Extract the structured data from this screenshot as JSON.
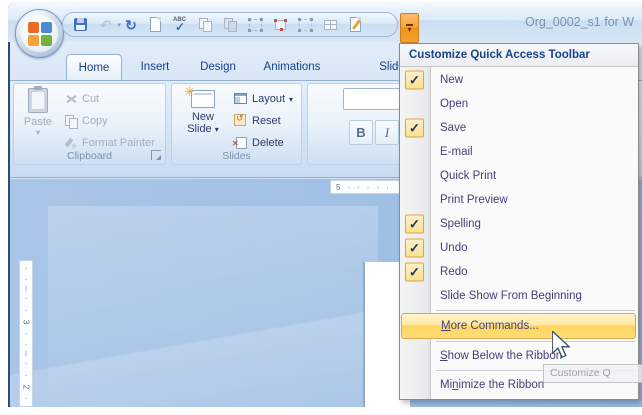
{
  "titlebar": {
    "title": "Org_0002_s1 for W"
  },
  "qat": {
    "icons": [
      {
        "name": "save",
        "disabled": false
      },
      {
        "name": "undo",
        "disabled": true,
        "has_dropdown": true
      },
      {
        "name": "redo",
        "disabled": false
      },
      {
        "name": "new-document",
        "disabled": false
      },
      {
        "name": "spelling",
        "disabled": false
      },
      {
        "name": "copy",
        "disabled": true
      },
      {
        "name": "duplicate",
        "disabled": true
      },
      {
        "name": "group-select",
        "disabled": true
      },
      {
        "name": "edit-points",
        "disabled": true
      },
      {
        "name": "select-objects",
        "disabled": true
      },
      {
        "name": "table",
        "disabled": true
      },
      {
        "name": "edit-slide",
        "disabled": false
      }
    ]
  },
  "tabs": [
    {
      "label": "Home",
      "active": true
    },
    {
      "label": "Insert",
      "active": false
    },
    {
      "label": "Design",
      "active": false
    },
    {
      "label": "Animations",
      "active": false
    },
    {
      "label": "Slide Show",
      "active": false
    }
  ],
  "ribbon": {
    "clipboard": {
      "group_label": "Clipboard",
      "paste_label": "Paste",
      "cut_label": "Cut",
      "copy_label": "Copy",
      "format_painter_label": "Format Painter"
    },
    "slides": {
      "group_label": "Slides",
      "new_slide_line1": "New",
      "new_slide_line2": "Slide",
      "layout_label": "Layout",
      "reset_label": "Reset",
      "delete_label": "Delete"
    },
    "font": {
      "bold_label": "B",
      "italic_label": "I"
    }
  },
  "menu": {
    "header": "Customize Quick Access Toolbar",
    "items": [
      {
        "label": "New",
        "checked": true
      },
      {
        "label": "Open",
        "checked": false
      },
      {
        "label": "Save",
        "checked": true
      },
      {
        "label": "E-mail",
        "checked": false
      },
      {
        "label": "Quick Print",
        "checked": false
      },
      {
        "label": "Print Preview",
        "checked": false
      },
      {
        "label": "Spelling",
        "checked": true
      },
      {
        "label": "Undo",
        "checked": true
      },
      {
        "label": "Redo",
        "checked": true
      },
      {
        "label": "Slide Show From Beginning",
        "checked": false
      },
      {
        "label": "More Commands...",
        "checked": false,
        "highlighted": true,
        "underline": 0,
        "separator_before": true
      },
      {
        "label": "Show Below the Ribbon",
        "checked": false,
        "underline": 0,
        "separator_before": true
      },
      {
        "label": "Minimize the Ribbon",
        "checked": false,
        "underline": 2,
        "separator_before": true
      }
    ]
  },
  "tooltip": {
    "text": "Customize Q"
  },
  "canvas": {
    "h_ruler_marks": [
      "5",
      "·",
      "·",
      "·",
      "·",
      "·"
    ],
    "v_ruler_marks": [
      "·",
      "·",
      "|",
      "·",
      "·",
      "3",
      "·",
      "·",
      "|",
      "·",
      "·",
      "2",
      "·"
    ]
  },
  "colors": {
    "highlight_orange": "#FFD55E",
    "check_fill": "#FBDF92",
    "check_border": "#DDA43B",
    "qat_dropdown_orange": "#EF9314",
    "menu_text": "#45407A",
    "menu_header_text": "#15428B",
    "workspace_blue": "#9FBFE4"
  }
}
